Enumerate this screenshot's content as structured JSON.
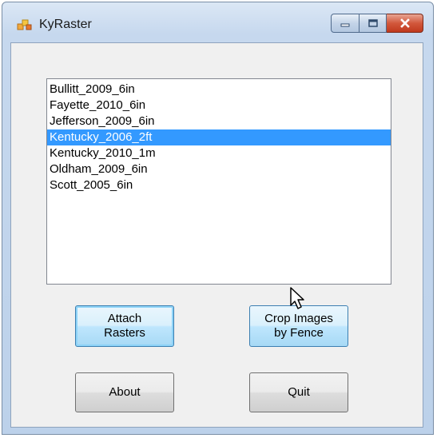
{
  "window": {
    "title": "KyRaster",
    "icons": {
      "app": "app-icon",
      "minimize": "minimize-icon",
      "maximize": "maximize-icon",
      "close": "close-icon"
    }
  },
  "list": {
    "items": [
      {
        "label": "Bullitt_2009_6in",
        "selected": false
      },
      {
        "label": "Fayette_2010_6in",
        "selected": false
      },
      {
        "label": "Jefferson_2009_6in",
        "selected": false
      },
      {
        "label": "Kentucky_2006_2ft",
        "selected": true
      },
      {
        "label": "Kentucky_2010_1m",
        "selected": false
      },
      {
        "label": "Oldham_2009_6in",
        "selected": false
      },
      {
        "label": "Scott_2005_6in",
        "selected": false
      }
    ]
  },
  "buttons": {
    "attach": "Attach\nRasters",
    "crop": "Crop Images\nby Fence",
    "about": "About",
    "quit": "Quit"
  },
  "colors": {
    "selection": "#3399ff",
    "close_button": "#c0391d"
  }
}
